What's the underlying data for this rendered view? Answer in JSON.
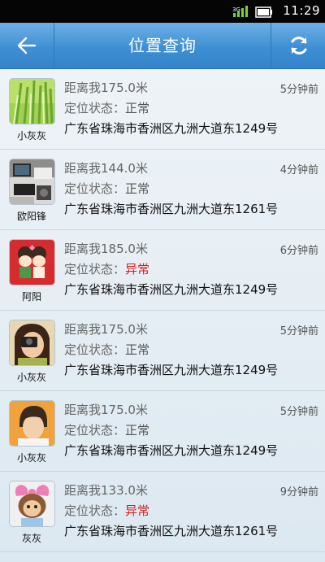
{
  "status_bar": {
    "time": "11:29"
  },
  "header": {
    "title": "位置查询",
    "back_icon": "arrow-left-icon",
    "refresh_icon": "refresh-icon"
  },
  "colors": {
    "error": "#d31d1d",
    "header": "#3f8fd4"
  },
  "items": [
    {
      "name": "小灰灰",
      "distance": "距离我175.0米",
      "time": "5分钟前",
      "state_label": "定位状态：",
      "state_value": "正常",
      "state_error": false,
      "address": "广东省珠海市香洲区九洲大道东1249号",
      "avatar": "grass-photo"
    },
    {
      "name": "欧阳锋",
      "distance": "距离我144.0米",
      "time": "4分钟前",
      "state_label": "定位状态：",
      "state_value": "正常",
      "state_error": false,
      "address": "广东省珠海市香洲区九洲大道东1261号",
      "avatar": "desk-photo"
    },
    {
      "name": "阿阳",
      "distance": "距离我185.0米",
      "time": "6分钟前",
      "state_label": "定位状态：",
      "state_value": "异常",
      "state_error": true,
      "address": "广东省珠海市香洲区九洲大道东1249号",
      "avatar": "cartoon-couple"
    },
    {
      "name": "小灰灰",
      "distance": "距离我175.0米",
      "time": "5分钟前",
      "state_label": "定位状态：",
      "state_value": "正常",
      "state_error": false,
      "address": "广东省珠海市香洲区九洲大道东1249号",
      "avatar": "camera-girl"
    },
    {
      "name": "小灰灰",
      "distance": "距离我175.0米",
      "time": "5分钟前",
      "state_label": "定位状态：",
      "state_value": "正常",
      "state_error": false,
      "address": "广东省珠海市香洲区九洲大道东1249号",
      "avatar": "boy-portrait"
    },
    {
      "name": "灰灰",
      "distance": "距离我133.0米",
      "time": "9分钟前",
      "state_label": "定位状态：",
      "state_value": "异常",
      "state_error": true,
      "address": "广东省珠海市香洲区九洲大道东1261号",
      "avatar": "doll-photo"
    }
  ]
}
